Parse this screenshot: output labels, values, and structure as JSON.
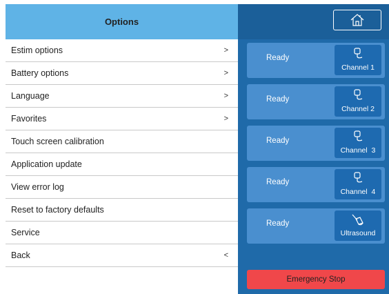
{
  "header": {
    "title": "Options"
  },
  "menu": [
    {
      "label": "Estim options",
      "chevron": ">"
    },
    {
      "label": "Battery options",
      "chevron": ">"
    },
    {
      "label": "Language",
      "chevron": ">"
    },
    {
      "label": "Favorites",
      "chevron": ">"
    },
    {
      "label": "Touch screen calibration",
      "chevron": ""
    },
    {
      "label": "Application update",
      "chevron": ""
    },
    {
      "label": "View error log",
      "chevron": ""
    },
    {
      "label": "Reset to factory defaults",
      "chevron": ""
    },
    {
      "label": "Service",
      "chevron": ""
    },
    {
      "label": "Back",
      "chevron": "<"
    }
  ],
  "channels": [
    {
      "status": "Ready",
      "label": "Channel 1",
      "icon": "electrode-icon"
    },
    {
      "status": "Ready",
      "label": "Channel 2",
      "icon": "electrode-icon"
    },
    {
      "status": "Ready",
      "label": "Channel  3",
      "icon": "electrode-icon"
    },
    {
      "status": "Ready",
      "label": "Channel  4",
      "icon": "electrode-icon"
    },
    {
      "status": "Ready",
      "label": "Ultrasound",
      "icon": "ultrasound-probe-icon"
    }
  ],
  "emergency_stop": {
    "label": "Emergency Stop"
  },
  "colors": {
    "header_blue": "#5fb3e6",
    "panel_blue": "#1f6aa9",
    "channel_blue": "#4a8fcf",
    "channel_box": "#1e6ab0",
    "stop_red": "#f0474a"
  }
}
